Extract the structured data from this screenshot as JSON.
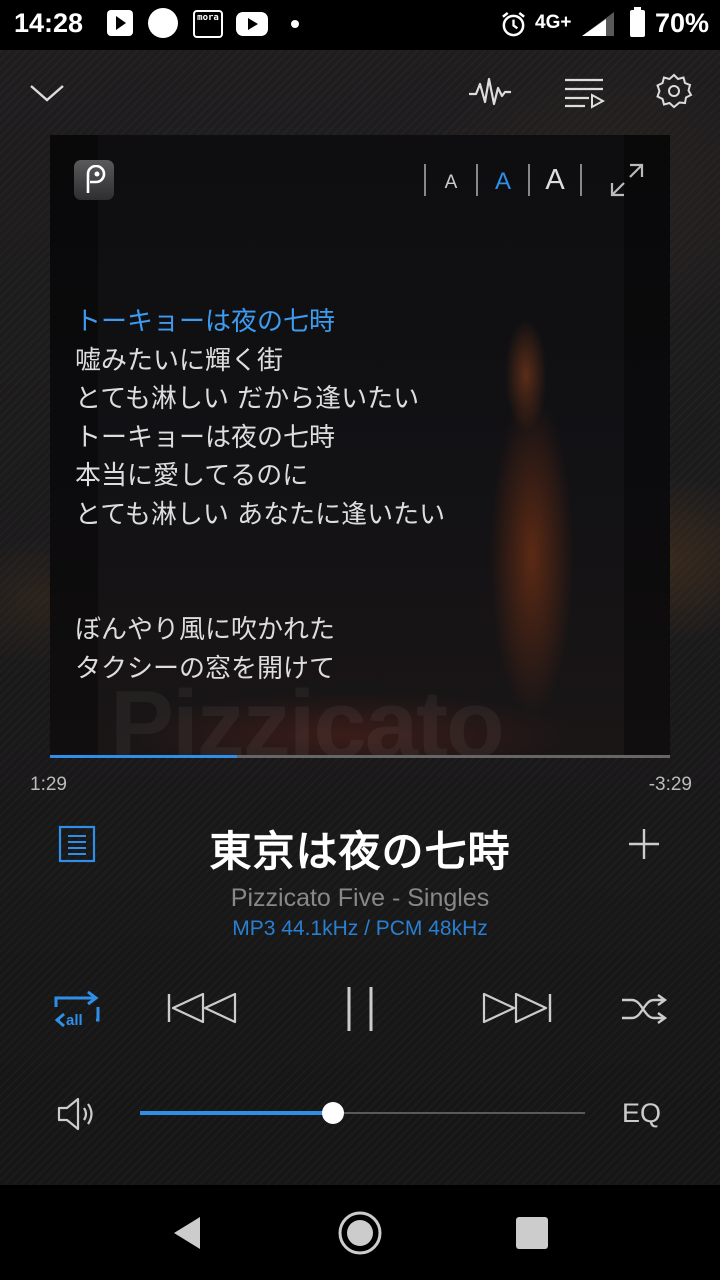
{
  "status_bar": {
    "time": "14:28",
    "mora_label": "mora",
    "network": "4G+",
    "battery": "70%"
  },
  "toolbar": {
    "icons": [
      "chevron-down-icon",
      "waveform-icon",
      "queue-icon",
      "gear-icon"
    ]
  },
  "lyrics_panel": {
    "watermark": "Pizzicato",
    "font_sizes": [
      "A",
      "A",
      "A"
    ],
    "selected_font_size": "medium",
    "lines": [
      "トーキョーは夜の七時",
      "嘘みたいに輝く街",
      "とても淋しい だから逢いたい",
      "トーキョーは夜の七時",
      "本当に愛してるのに",
      "とても淋しい あなたに逢いたい"
    ],
    "lines_after_gap": [
      "ぼんやり風に吹かれた",
      "タクシーの窓を開けて"
    ],
    "current_line_index": 0,
    "progress_fraction": 0.302
  },
  "playback": {
    "elapsed": "1:29",
    "remaining": "-3:29"
  },
  "track": {
    "title": "東京は夜の七時",
    "artist_album": "Pizzicato Five - Singles",
    "format": "MP3 44.1kHz / PCM 48kHz"
  },
  "controls": {
    "repeat_label": "all",
    "state": "playing"
  },
  "volume": {
    "level_fraction": 0.433,
    "eq_label": "EQ"
  },
  "colors": {
    "accent": "#2f8fe8",
    "background": "#1c1b1c"
  }
}
